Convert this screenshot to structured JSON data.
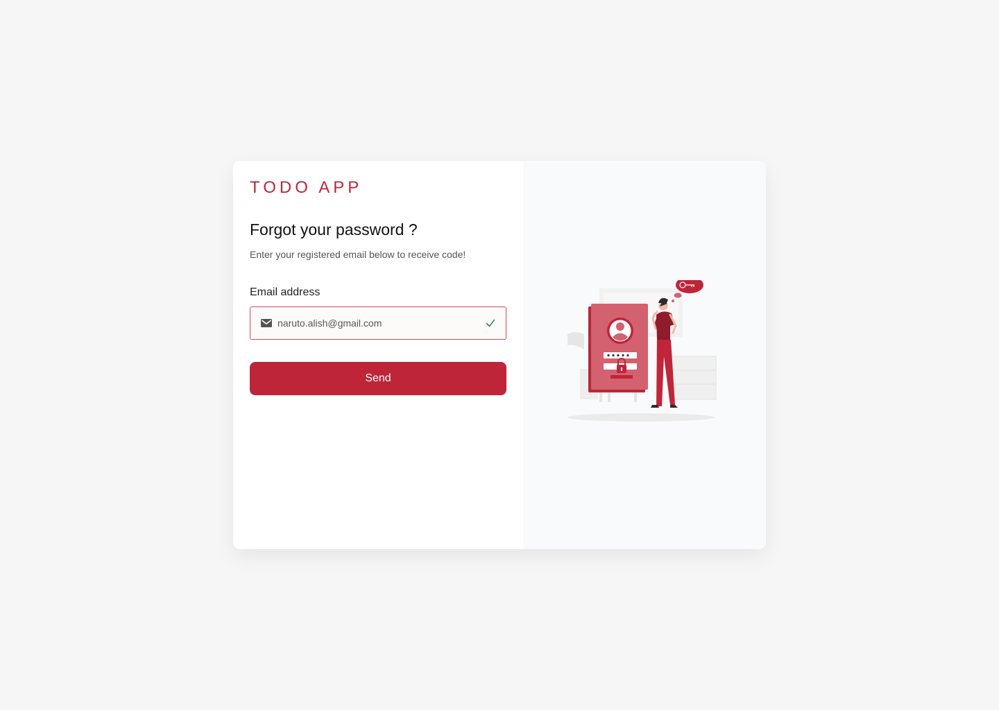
{
  "brand": {
    "name": "TODO APP"
  },
  "form": {
    "title": "Forgot your password ?",
    "subtitle": "Enter your registered email below to receive code!",
    "email_label": "Email address",
    "email_value": "naruto.alish@gmail.com",
    "send_label": "Send"
  },
  "icons": {
    "email_field": "mail-icon",
    "validation": "check-icon",
    "illustration": "forgot-password-illustration"
  },
  "colors": {
    "accent": "#bf2538",
    "input_border": "#d94a57",
    "check": "#2e8b57",
    "background": "#f6f6f6",
    "illustration_panel": "#f9fafb"
  }
}
